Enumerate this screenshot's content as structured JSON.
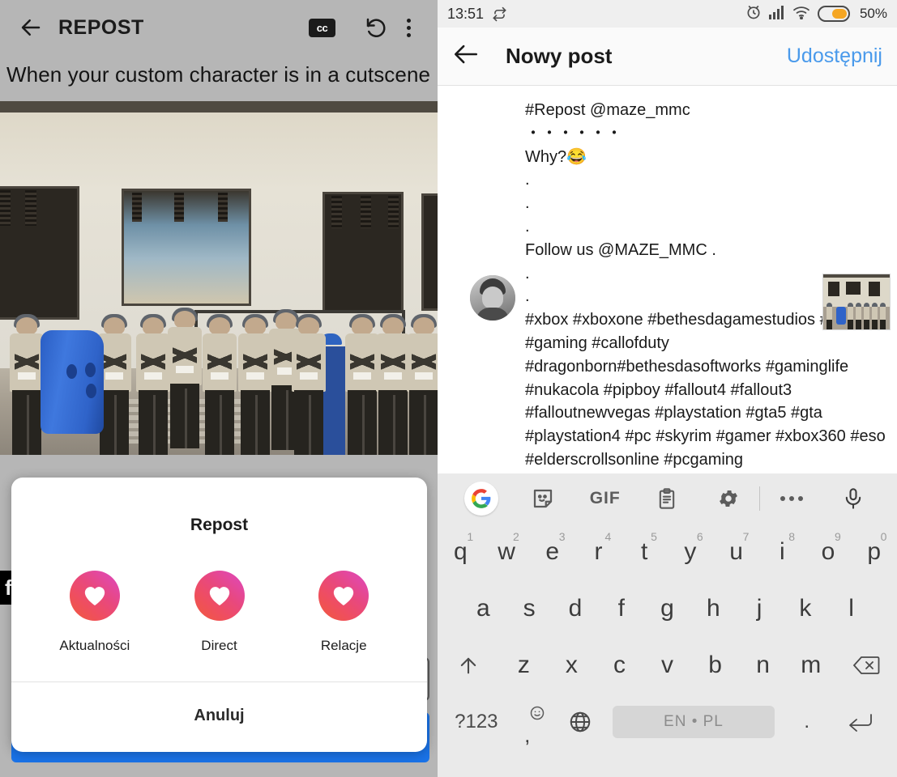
{
  "left_panel": {
    "header": {
      "back_icon": "back-arrow-icon",
      "title": "REPOST",
      "cc_label": "cc",
      "rotate_icon": "rotate-left-icon",
      "menu_icon": "overflow-menu-icon"
    },
    "caption": "When your custom character is in a cutscene",
    "image_alt": "police cadets in formation, one wearing a blue barrel",
    "hidden_band_text": "f",
    "dialog": {
      "title": "Repost",
      "options": [
        {
          "label": "Aktualności",
          "icon": "heart-icon"
        },
        {
          "label": "Direct",
          "icon": "heart-icon"
        },
        {
          "label": "Relacje",
          "icon": "heart-icon"
        }
      ],
      "cancel_label": "Anuluj"
    }
  },
  "right_panel": {
    "statusbar": {
      "time": "13:51",
      "repost_icon": "repost-icon",
      "alarm_icon": "alarm-clock-icon",
      "signal_icon": "signal-bars-icon",
      "wifi_icon": "wifi-icon",
      "battery_icon": "battery-icon",
      "battery_percent": "50%"
    },
    "header": {
      "back_icon": "back-arrow-icon",
      "title": "Nowy post",
      "share_label": "Udostępnij"
    },
    "post": {
      "text": "#Repost @maze_mmc\n・・・・・・\nWhy?😂\n.\n.\n.\nFollow us @MAZE_MMC .\n.\n.\n#xbox #xboxone #bethesdagamestudios #fallout #gaming #callofduty #dragonborn#bethesdasoftworks #gaminglife #nukacola #pipboy #fallout4 #fallout3 #falloutnewvegas #playstation #gta5 #gta #playstation4 #pc #skyrim #gamer #xbox360 #eso #elderscrollsonline #pcgaming",
      "avatar_icon": "avatar",
      "thumbnail_icon": "post-thumbnail"
    },
    "keyboard": {
      "toolbar": [
        {
          "name": "google-logo-icon",
          "label": "G"
        },
        {
          "name": "sticker-icon",
          "label": ""
        },
        {
          "name": "gif-icon",
          "label": "GIF"
        },
        {
          "name": "clipboard-icon",
          "label": ""
        },
        {
          "name": "gear-icon",
          "label": ""
        },
        {
          "name": "more-icon",
          "label": ""
        },
        {
          "name": "microphone-icon",
          "label": ""
        }
      ],
      "row1": [
        {
          "key": "q",
          "num": "1"
        },
        {
          "key": "w",
          "num": "2"
        },
        {
          "key": "e",
          "num": "3"
        },
        {
          "key": "r",
          "num": "4"
        },
        {
          "key": "t",
          "num": "5"
        },
        {
          "key": "y",
          "num": "6"
        },
        {
          "key": "u",
          "num": "7"
        },
        {
          "key": "i",
          "num": "8"
        },
        {
          "key": "o",
          "num": "9"
        },
        {
          "key": "p",
          "num": "0"
        }
      ],
      "row2": [
        "a",
        "s",
        "d",
        "f",
        "g",
        "h",
        "j",
        "k",
        "l"
      ],
      "row3": [
        "z",
        "x",
        "c",
        "v",
        "b",
        "n",
        "m"
      ],
      "shift_icon": "shift-arrow-icon",
      "backspace_icon": "backspace-icon",
      "symbols_label": "?123",
      "emoji_icon": "emoji-comma-key",
      "emoji_comma": ",",
      "globe_icon": "language-globe-icon",
      "space_label": "EN • PL",
      "period_label": ".",
      "enter_icon": "enter-icon"
    }
  },
  "colors": {
    "accent_blue": "#4a9aeb",
    "ig_pink": "#e8487f",
    "ig_orange": "#f05a3c",
    "battery_orange": "#f5a623",
    "left_bg": "#b6b6b6"
  }
}
